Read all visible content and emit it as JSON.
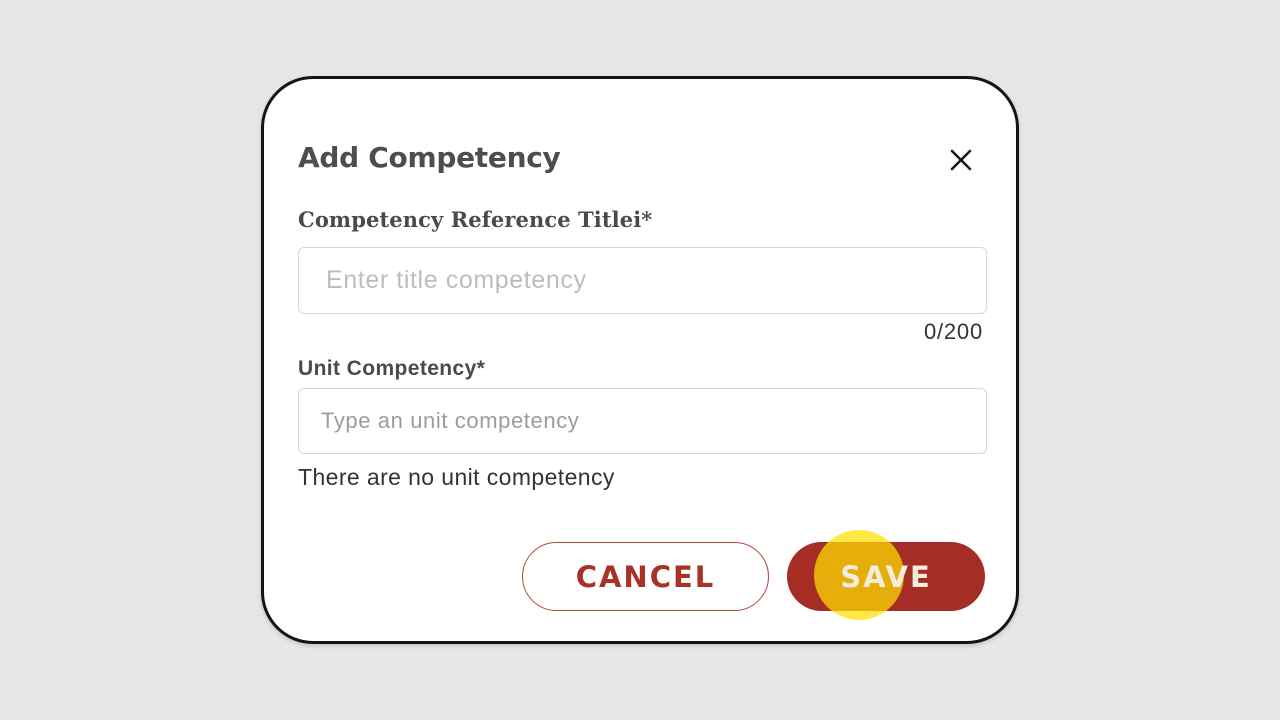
{
  "dialog": {
    "title": "Add Competency",
    "close_icon": "close-icon"
  },
  "form": {
    "title_field": {
      "label": "Competency Reference Titlei*",
      "placeholder": "Enter title competency",
      "value": "",
      "counter": "0/200"
    },
    "unit_field": {
      "label": "Unit Competency*",
      "placeholder": "Type an unit competency",
      "value": "",
      "empty_message": "There are no unit competency"
    }
  },
  "actions": {
    "cancel_label": "CANCEL",
    "save_label": "SAVE"
  },
  "colors": {
    "background": "#e6e6e6",
    "dialog_border": "#151515",
    "primary": "#a62d26",
    "cancel_text": "#a93227",
    "cursor_highlight": "#ffe100"
  }
}
